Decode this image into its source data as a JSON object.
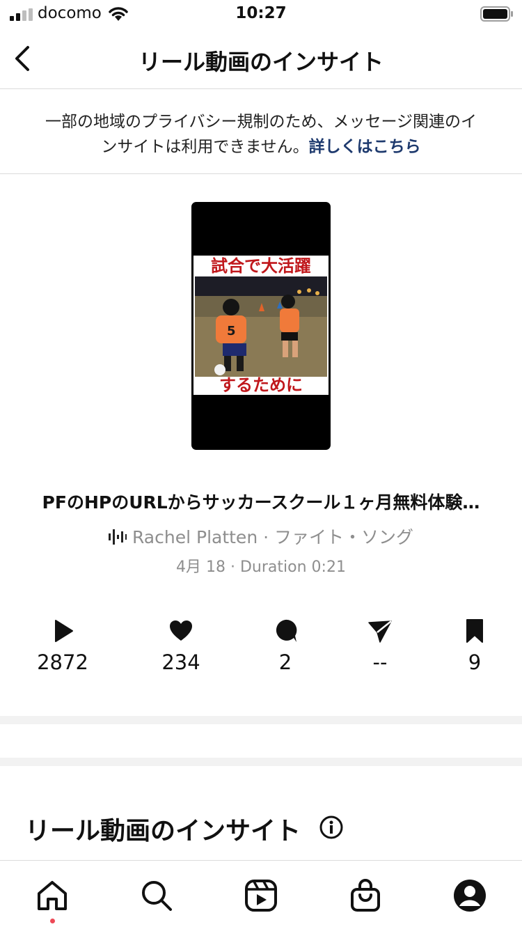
{
  "status_bar": {
    "carrier": "docomo",
    "time": "10:27"
  },
  "header": {
    "title": "リール動画のインサイト"
  },
  "privacy_notice": {
    "text": "一部の地域のプライバシー規制のため、メッセージ関連のインサイトは利用できません。",
    "link": "詳しくはこちら"
  },
  "thumbnail": {
    "caption_top": "試合で大活躍",
    "caption_bottom": "するために"
  },
  "post": {
    "title": "PFのHPのURLからサッカースクール１ヶ月無料体験…",
    "music": "Rachel Platten · ファイト・ソング",
    "meta": "4月 18 · Duration 0:21"
  },
  "stats": {
    "plays": "2872",
    "likes": "234",
    "comments": "2",
    "shares": "--",
    "saves": "9"
  },
  "insights": {
    "heading": "リール動画のインサイト"
  },
  "icons": [
    "back-arrow-icon",
    "play-icon",
    "heart-icon",
    "comment-icon",
    "send-icon",
    "bookmark-icon",
    "info-icon",
    "home-icon",
    "search-icon",
    "reels-icon",
    "shop-icon",
    "profile-icon"
  ],
  "colors": {
    "link": "#1e3a6e",
    "caption": "#c0171b",
    "notification_dot": "#ed4956",
    "muted_text": "#8e8e8e"
  }
}
